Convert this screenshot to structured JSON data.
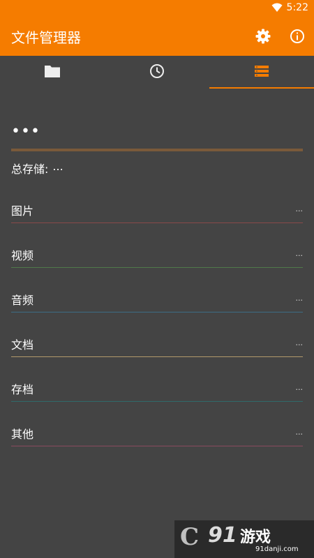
{
  "status_bar": {
    "time": "5:22",
    "wifi_icon": "wifi-icon"
  },
  "app_bar": {
    "title": "文件管理器",
    "settings_icon": "gear-icon",
    "info_icon": "info-icon",
    "color": "#f57c00"
  },
  "tabs": [
    {
      "icon": "folder-icon",
      "selected": false
    },
    {
      "icon": "clock-icon",
      "selected": false
    },
    {
      "icon": "storage-icon",
      "selected": true
    }
  ],
  "storage": {
    "value": "•••",
    "total_label": "总存储:",
    "total_value": "..."
  },
  "categories": [
    {
      "label": "图片",
      "size": "...",
      "color": "#8a4a4a"
    },
    {
      "label": "视频",
      "size": "...",
      "color": "#4f7a4a"
    },
    {
      "label": "音频",
      "size": "...",
      "color": "#3d6d86"
    },
    {
      "label": "文档",
      "size": "...",
      "color": "#b39a6a"
    },
    {
      "label": "存档",
      "size": "...",
      "color": "#2f6a6a"
    },
    {
      "label": "其他",
      "size": "...",
      "color": "#8a4a5e"
    }
  ],
  "watermark": {
    "brand": "游戏",
    "prefix": "91",
    "url": "91danji.com"
  }
}
